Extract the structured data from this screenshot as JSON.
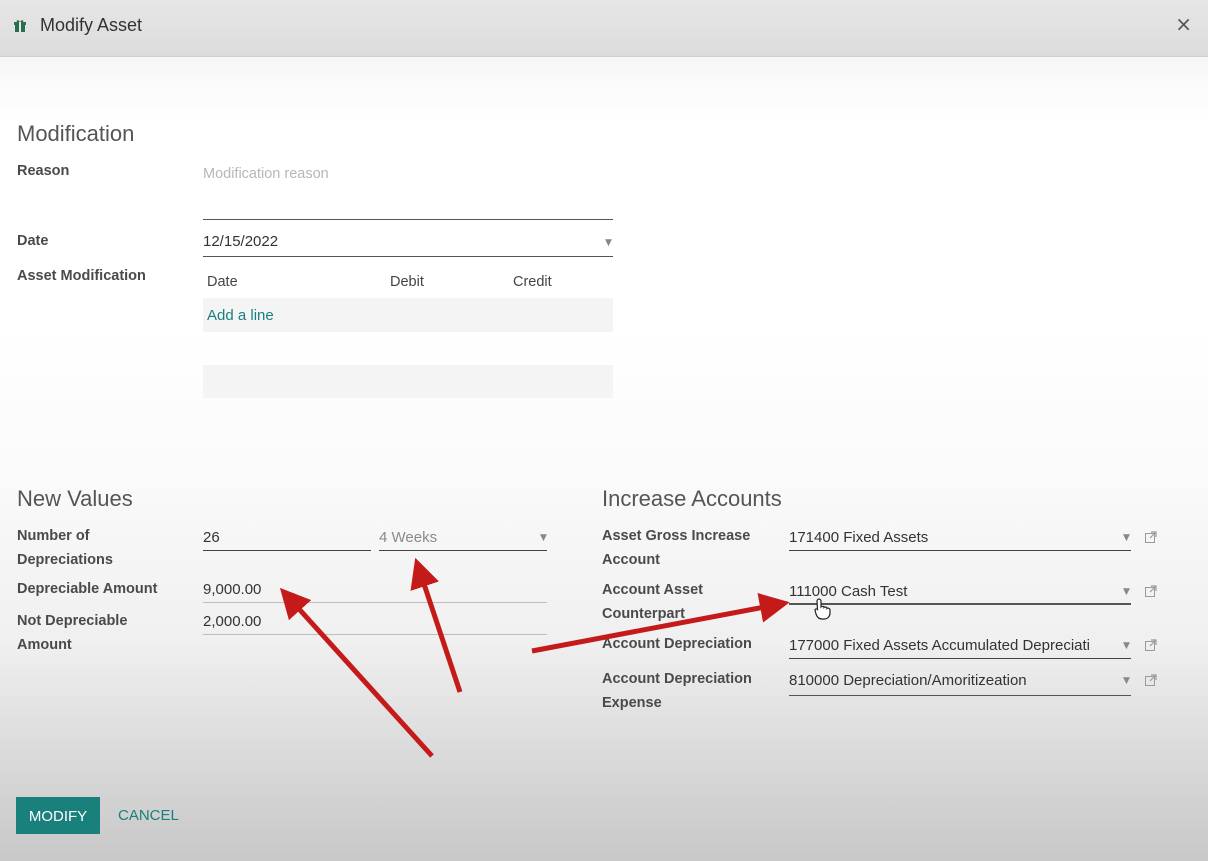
{
  "dialog": {
    "title": "Modify Asset",
    "close_glyph": "×"
  },
  "modification": {
    "heading": "Modification",
    "reason_label": "Reason",
    "reason_placeholder": "Modification reason",
    "date_label": "Date",
    "date_value": "12/15/2022",
    "asset_modification_label": "Asset Modification",
    "table_columns": [
      "Date",
      "Debit",
      "Credit"
    ],
    "add_line": "Add a line"
  },
  "new_values": {
    "heading": "New Values",
    "num_depreciations_label_line1": "Number of",
    "num_depreciations_label_line2": "Depreciations",
    "num_depreciations_value": "26",
    "period_value": "4 Weeks",
    "depreciable_amount_label": "Depreciable Amount",
    "depreciable_amount_value": "9,000.00",
    "not_depreciable_label_line1": "Not Depreciable",
    "not_depreciable_label_line2": "Amount",
    "not_depreciable_value": "2,000.00"
  },
  "increase_accounts": {
    "heading": "Increase Accounts",
    "gross_increase_label_line1": "Asset Gross Increase",
    "gross_increase_label_line2": "Account",
    "gross_increase_value": "171400 Fixed Assets",
    "counterpart_label_line1": "Account Asset",
    "counterpart_label_line2": "Counterpart",
    "counterpart_value": "111000 Cash Test",
    "depreciation_label": "Account Depreciation",
    "depreciation_value": "177000 Fixed Assets Accumulated Depreciati",
    "expense_label_line1": "Account Depreciation",
    "expense_label_line2": "Expense",
    "expense_value": "810000 Depreciation/Amoritizeation"
  },
  "footer": {
    "modify_label": "MODIFY",
    "cancel_label": "CANCEL"
  },
  "icons": {
    "header_icon": "asset-icon",
    "dropdown": "caret-down-icon",
    "external": "external-link-icon"
  },
  "colors": {
    "accent": "#19807c",
    "annotation_arrow": "#c41a1a"
  }
}
